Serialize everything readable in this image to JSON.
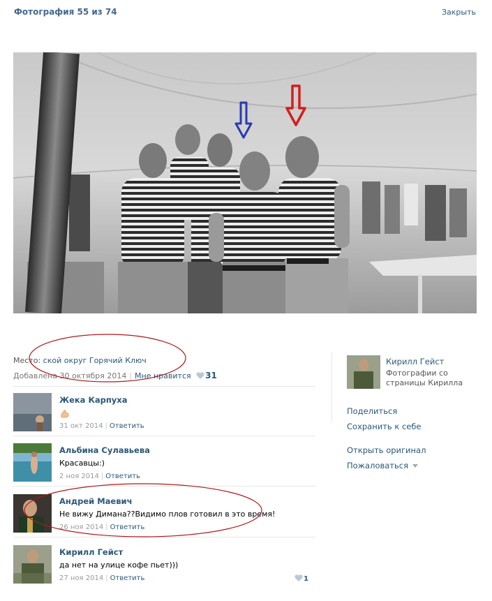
{
  "header": {
    "title": "Фотография 55 из 74",
    "close_label": "Закрыть"
  },
  "photo": {
    "description": "Black and white group photo of five men in striped shirts inside a tent",
    "arrows": [
      {
        "color": "#2a3ab0",
        "label": "blue-arrow"
      },
      {
        "color": "#d41e1e",
        "label": "red-arrow"
      }
    ]
  },
  "info": {
    "place_label": "Место:",
    "place_value": "ской округ Горячий Ключ",
    "added": "Добавлена 30 октября 2014",
    "like_label": "Мне нравится",
    "like_count": "31"
  },
  "comments": [
    {
      "author": "Жека Карпуха",
      "text": "",
      "has_emoji": true,
      "date": "31 окт 2014",
      "reply": "Ответить",
      "likes": ""
    },
    {
      "author": "Альбина Сулавьева",
      "text": "Красавцы:)",
      "has_emoji": false,
      "date": "2 ноя 2014",
      "reply": "Ответить",
      "likes": ""
    },
    {
      "author": "Андрей Маевич",
      "text": "Не вижу Димана??Видимо плов готовил в это время!",
      "has_emoji": false,
      "date": "26 ноя 2014",
      "reply": "Ответить",
      "likes": ""
    },
    {
      "author": "Кирилл Гейст",
      "text": "да нет на улице кофе пьет)))",
      "has_emoji": false,
      "date": "27 ноя 2014",
      "reply": "Ответить",
      "likes": "1"
    }
  ],
  "owner": {
    "name": "Кирилл Гейст",
    "desc": "Фотографии со страницы Кирилла"
  },
  "actions": {
    "share": "Поделиться",
    "save": "Сохранить к себе",
    "open_original": "Открыть оригинал",
    "report": "Пожаловаться"
  },
  "colors": {
    "link": "#2b587a",
    "title": "#45688e",
    "annotation_oval": "#b01818"
  }
}
